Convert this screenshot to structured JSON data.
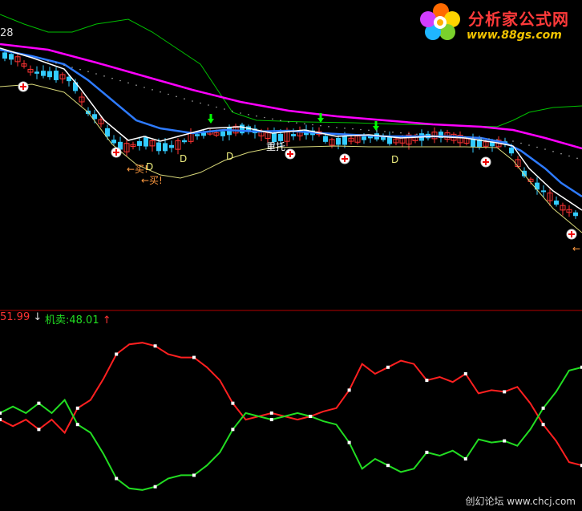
{
  "logo": {
    "title": "分析家公式网",
    "url": "www.88gs.com"
  },
  "price_tick": "28",
  "indicator": {
    "buy_label": "51.99",
    "sell_label": "机卖:48.01"
  },
  "watermark": "创幻论坛 www.chcj.com",
  "colors": {
    "up": "#ff3333",
    "down": "#33ccff",
    "white_line": "#ffffff",
    "blue_line": "#2e7bff",
    "magenta_line": "#ff00ff",
    "yellow_line": "#d8d87a",
    "green_line": "#00c000",
    "red_curve": "#ff2020",
    "green_curve": "#22dd22",
    "separator": "#b40000"
  },
  "chart_data": [
    {
      "type": "candlestick",
      "annotations": {
        "buy_text": "买!",
        "d_marker": "D",
        "special_text": "重托"
      },
      "overlays": [
        "white",
        "blue",
        "magenta",
        "yellow",
        "green"
      ]
    },
    {
      "type": "line",
      "series": [
        {
          "values": [
            48,
            44,
            48,
            42,
            48,
            40,
            55,
            60,
            73,
            88,
            94,
            95,
            93,
            88,
            86,
            86,
            80,
            72,
            58,
            48,
            50,
            52,
            50,
            48,
            50,
            53,
            55,
            66,
            82,
            76,
            80,
            84,
            82,
            72,
            74,
            71,
            76,
            64,
            66,
            65,
            68,
            58,
            45,
            35,
            22,
            20
          ]
        },
        {
          "values": [
            52,
            56,
            52,
            58,
            52,
            60,
            45,
            40,
            27,
            12,
            6,
            5,
            7,
            12,
            14,
            14,
            20,
            28,
            42,
            52,
            50,
            48,
            50,
            52,
            50,
            47,
            45,
            34,
            18,
            24,
            20,
            16,
            18,
            28,
            26,
            29,
            24,
            36,
            34,
            35,
            32,
            42,
            55,
            65,
            78,
            80
          ]
        }
      ]
    }
  ]
}
